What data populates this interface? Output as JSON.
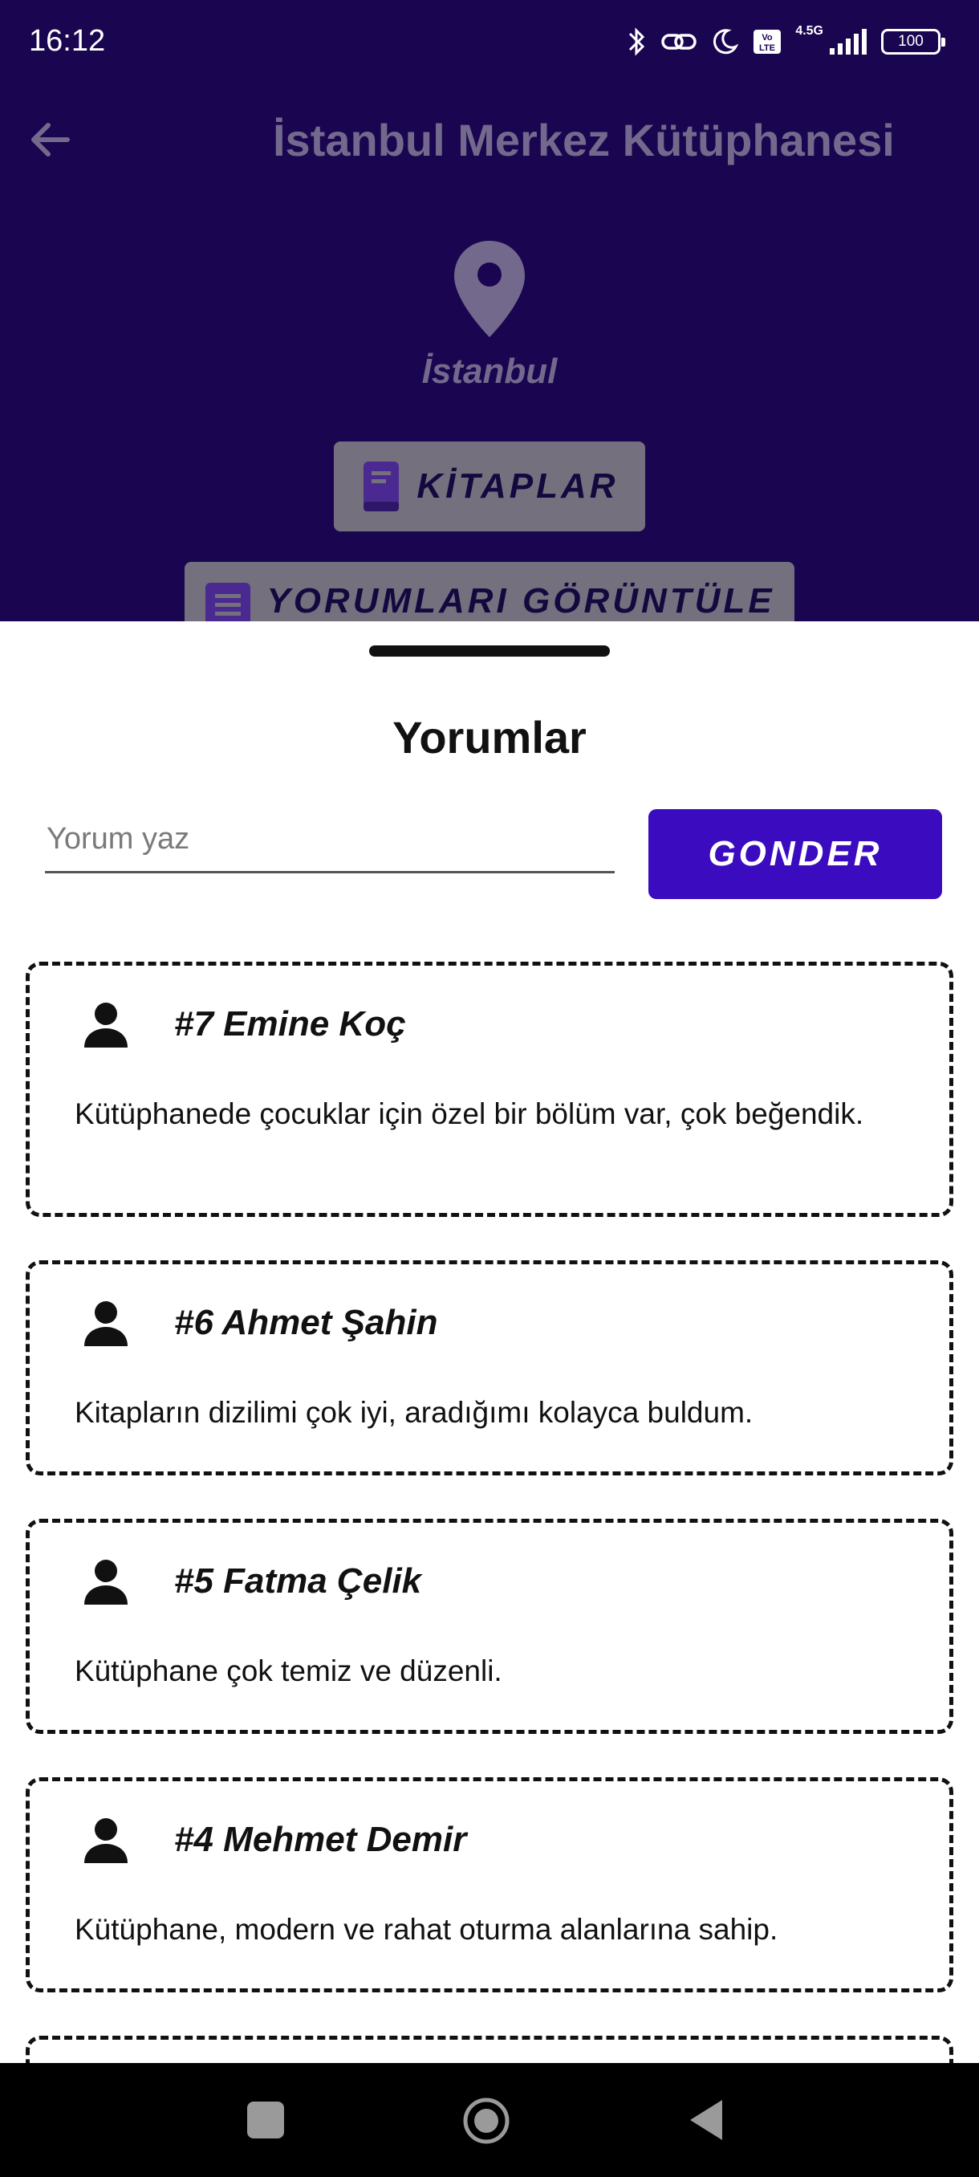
{
  "status_bar": {
    "time": "16:12",
    "network": "4.5G",
    "battery": "100"
  },
  "app_bar": {
    "title": "İstanbul Merkez Kütüphanesi"
  },
  "library": {
    "city": "İstanbul",
    "books_button": "KİTAPLAR",
    "comments_button": "YORUMLARI GÖRÜNTÜLE"
  },
  "sheet": {
    "title": "Yorumlar",
    "input_placeholder": "Yorum yaz",
    "send_button": "GONDER",
    "comments": [
      {
        "author": "#7 Emine Koç",
        "text": "Kütüphanede çocuklar için özel bir bölüm var, çok beğendik."
      },
      {
        "author": "#6 Ahmet Şahin",
        "text": "Kitapların dizilimi çok iyi, aradığımı kolayca buldum."
      },
      {
        "author": "#5 Fatma Çelik",
        "text": "Kütüphane çok temiz ve düzenli."
      },
      {
        "author": "#4 Mehmet Demir",
        "text": "Kütüphane, modern ve rahat oturma alanlarına sahip."
      }
    ]
  },
  "colors": {
    "header_bg": "#1a0550",
    "accent": "#3a0bbf",
    "dimmed_text": "#73698c"
  },
  "icons": {
    "back": "arrow-left-icon",
    "location": "map-pin-icon",
    "book": "book-icon",
    "comments": "comment-list-icon",
    "user": "person-icon"
  }
}
